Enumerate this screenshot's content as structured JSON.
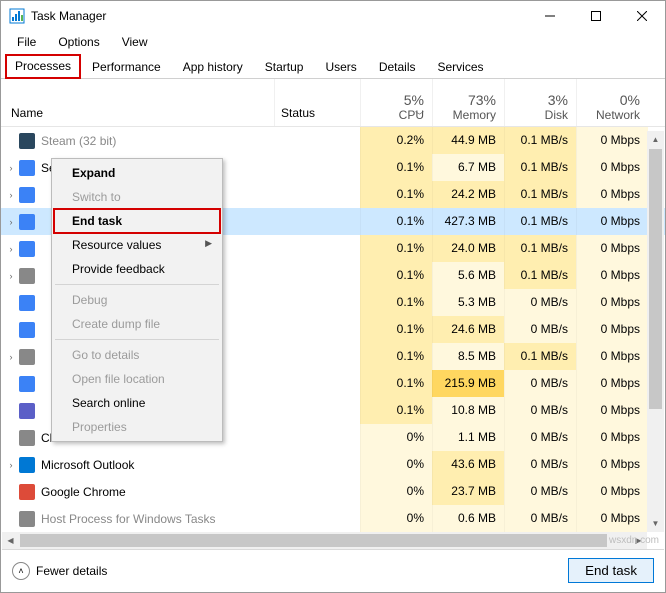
{
  "window": {
    "title": "Task Manager"
  },
  "menu": {
    "file": "File",
    "options": "Options",
    "view": "View"
  },
  "tabs": {
    "processes": "Processes",
    "performance": "Performance",
    "apphistory": "App history",
    "startup": "Startup",
    "users": "Users",
    "details": "Details",
    "services": "Services"
  },
  "columns": {
    "name": "Name",
    "status": "Status",
    "cpu": {
      "pct": "5%",
      "label": "CPU"
    },
    "memory": {
      "pct": "73%",
      "label": "Memory"
    },
    "disk": {
      "pct": "3%",
      "label": "Disk"
    },
    "network": {
      "pct": "0%",
      "label": "Network"
    }
  },
  "processes": [
    {
      "name": "Steam (32 bit)",
      "exp": "",
      "cpu": "0.2%",
      "mem": "44.9 MB",
      "disk": "0.1 MB/s",
      "net": "0 Mbps",
      "iconColor": "#2a475e",
      "h": [
        "h1",
        "h1",
        "h1",
        "h0"
      ],
      "cut": true
    },
    {
      "name": "Service Host: Network Svc…",
      "exp": "›",
      "cpu": "0.1%",
      "mem": "6.7 MB",
      "disk": "0.1 MB/s",
      "net": "0 Mbps",
      "iconColor": "#3b82f6",
      "h": [
        "h1",
        "h0",
        "h1",
        "h0"
      ]
    },
    {
      "name": "",
      "exp": "›",
      "cpu": "0.1%",
      "mem": "24.2 MB",
      "disk": "0.1 MB/s",
      "net": "0 Mbps",
      "iconColor": "#3b82f6",
      "h": [
        "h1",
        "h1",
        "h1",
        "h0"
      ]
    },
    {
      "name": "",
      "exp": "›",
      "cpu": "0.1%",
      "mem": "427.3 MB",
      "disk": "0.1 MB/s",
      "net": "0 Mbps",
      "iconColor": "#3b82f6",
      "h": [
        "h1",
        "h4",
        "h1",
        "h0"
      ],
      "selected": true
    },
    {
      "name": "",
      "exp": "›",
      "cpu": "0.1%",
      "mem": "24.0 MB",
      "disk": "0.1 MB/s",
      "net": "0 Mbps",
      "iconColor": "#3b82f6",
      "h": [
        "h1",
        "h1",
        "h1",
        "h0"
      ]
    },
    {
      "name": "",
      "exp": "›",
      "cpu": "0.1%",
      "mem": "5.6 MB",
      "disk": "0.1 MB/s",
      "net": "0 Mbps",
      "iconColor": "#888888",
      "h": [
        "h1",
        "h0",
        "h1",
        "h0"
      ]
    },
    {
      "name": "",
      "exp": "",
      "cpu": "0.1%",
      "mem": "5.3 MB",
      "disk": "0 MB/s",
      "net": "0 Mbps",
      "iconColor": "#3b82f6",
      "h": [
        "h1",
        "h0",
        "h0",
        "h0"
      ]
    },
    {
      "name": "",
      "exp": "",
      "cpu": "0.1%",
      "mem": "24.6 MB",
      "disk": "0 MB/s",
      "net": "0 Mbps",
      "iconColor": "#3b82f6",
      "h": [
        "h1",
        "h1",
        "h0",
        "h0"
      ]
    },
    {
      "name": "",
      "exp": "›",
      "cpu": "0.1%",
      "mem": "8.5 MB",
      "disk": "0.1 MB/s",
      "net": "0 Mbps",
      "iconColor": "#888888",
      "h": [
        "h1",
        "h0",
        "h1",
        "h0"
      ]
    },
    {
      "name": "",
      "exp": "",
      "cpu": "0.1%",
      "mem": "215.9 MB",
      "disk": "0 MB/s",
      "net": "0 Mbps",
      "iconColor": "#3b82f6",
      "h": [
        "h1",
        "h3",
        "h0",
        "h0"
      ]
    },
    {
      "name": "",
      "exp": "",
      "cpu": "0.1%",
      "mem": "10.8 MB",
      "disk": "0 MB/s",
      "net": "0 Mbps",
      "iconColor": "#5b5fc7",
      "h": [
        "h1",
        "h0",
        "h0",
        "h0"
      ]
    },
    {
      "name": "Client Server Runtime Process",
      "exp": "",
      "cpu": "0%",
      "mem": "1.1 MB",
      "disk": "0 MB/s",
      "net": "0 Mbps",
      "iconColor": "#888888",
      "h": [
        "h0",
        "h0",
        "h0",
        "h0"
      ]
    },
    {
      "name": "Microsoft Outlook",
      "exp": "›",
      "cpu": "0%",
      "mem": "43.6 MB",
      "disk": "0 MB/s",
      "net": "0 Mbps",
      "iconColor": "#0078d4",
      "h": [
        "h0",
        "h1",
        "h0",
        "h0"
      ]
    },
    {
      "name": "Google Chrome",
      "exp": "",
      "cpu": "0%",
      "mem": "23.7 MB",
      "disk": "0 MB/s",
      "net": "0 Mbps",
      "iconColor": "#dd4b39",
      "h": [
        "h0",
        "h1",
        "h0",
        "h0"
      ]
    },
    {
      "name": "Host Process for Windows Tasks",
      "exp": "",
      "cpu": "0%",
      "mem": "0.6 MB",
      "disk": "0 MB/s",
      "net": "0 Mbps",
      "iconColor": "#888888",
      "h": [
        "h0",
        "h0",
        "h0",
        "h0"
      ],
      "cut": true
    }
  ],
  "context_menu": {
    "expand": "Expand",
    "switch_to": "Switch to",
    "end_task": "End task",
    "resource_values": "Resource values",
    "provide_feedback": "Provide feedback",
    "debug": "Debug",
    "create_dump": "Create dump file",
    "go_to_details": "Go to details",
    "open_file_location": "Open file location",
    "search_online": "Search online",
    "properties": "Properties"
  },
  "footer": {
    "fewer_details": "Fewer details",
    "end_task": "End task"
  },
  "watermark": "wsxdn.com"
}
